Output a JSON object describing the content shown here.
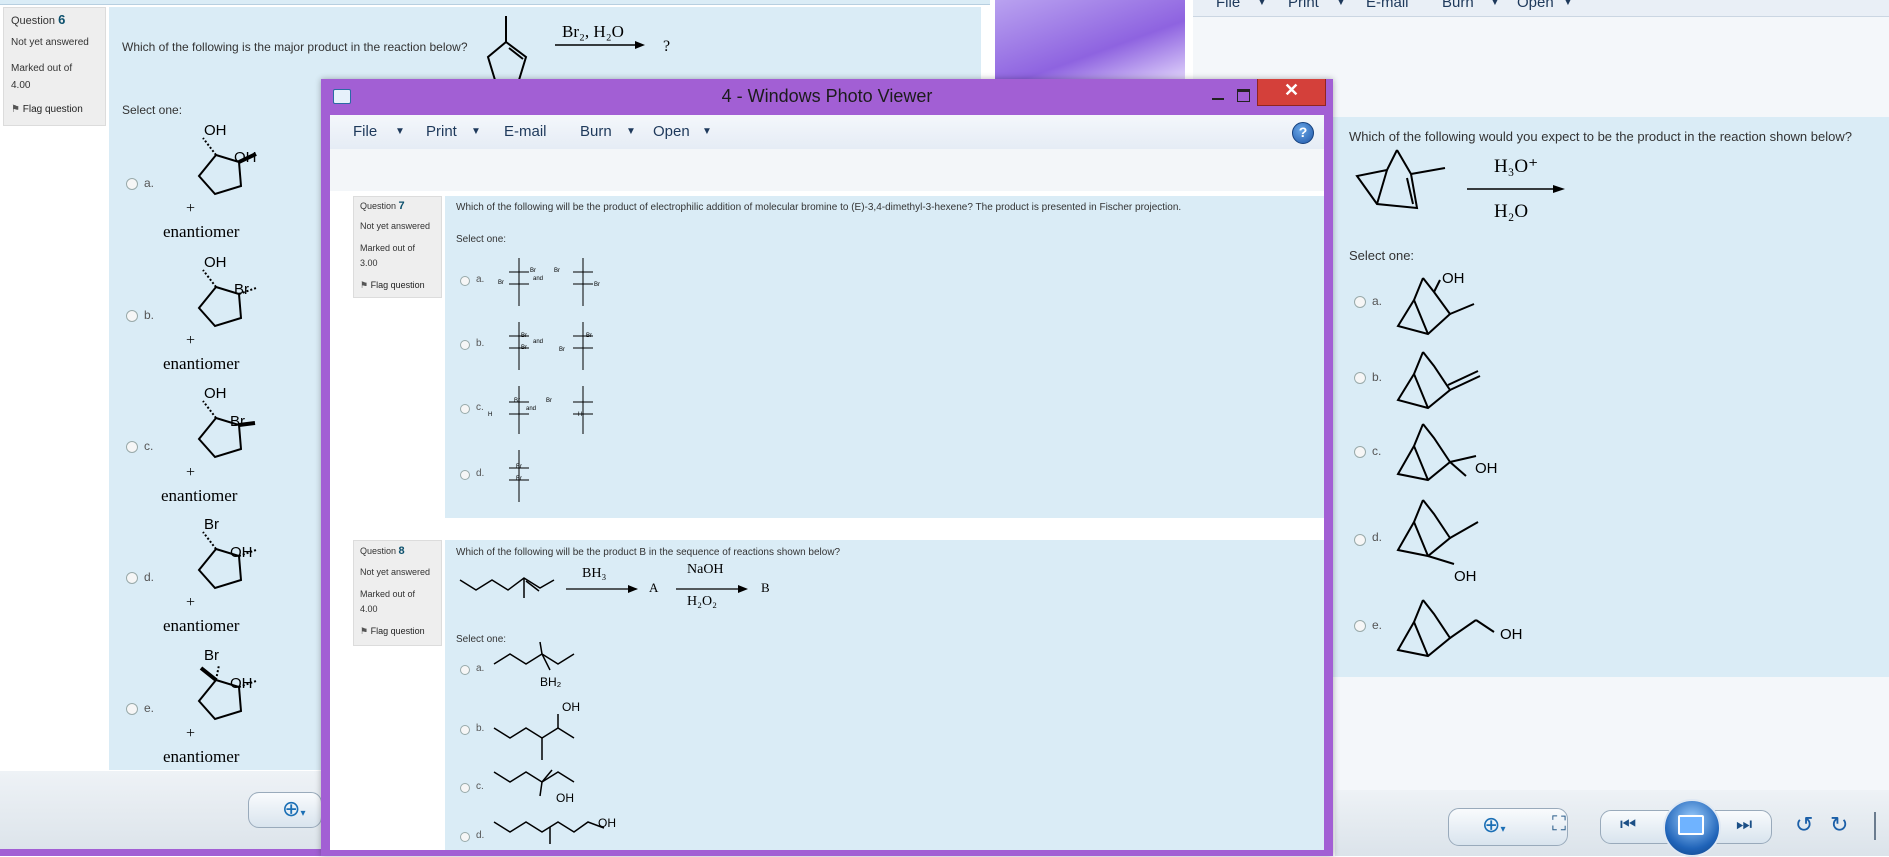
{
  "left_window": {
    "question": {
      "label": "Question",
      "number": "6",
      "state": "Not yet answered",
      "marked_label": "Marked out of",
      "marked_value": "4.00",
      "flag": "Flag question",
      "text": "Which of the following is the major product in the reaction below?",
      "reagent": "Br₂, H₂O",
      "product_placeholder": "?",
      "select_one": "Select one:",
      "options": [
        {
          "letter": "a.",
          "plus": "+",
          "enantiomer": "enantiomer",
          "sub1": "OH",
          "sub2": "OH"
        },
        {
          "letter": "b.",
          "plus": "+",
          "enantiomer": "enantiomer",
          "sub1": "OH",
          "sub2": "Br"
        },
        {
          "letter": "c.",
          "plus": "+",
          "enantiomer": "enantiomer",
          "sub1": "OH",
          "sub2": "Br"
        },
        {
          "letter": "d.",
          "plus": "+",
          "enantiomer": "enantiomer",
          "sub1": "Br",
          "sub2": "OH"
        },
        {
          "letter": "e.",
          "plus": "+",
          "enantiomer": "enantiomer",
          "sub1": "Br",
          "sub2": "OH"
        }
      ]
    }
  },
  "right_window": {
    "toolbar": [
      "File",
      "Print",
      "E-mail",
      "Burn",
      "Open"
    ],
    "question": {
      "text": "Which of the following would you expect to be the product in the reaction shown below?",
      "reagent_top": "H₃O⁺",
      "reagent_bottom": "H₂O",
      "select_one": "Select one:",
      "options": [
        {
          "letter": "a.",
          "label": "OH"
        },
        {
          "letter": "b.",
          "label": ""
        },
        {
          "letter": "c.",
          "label": "OH"
        },
        {
          "letter": "d.",
          "label": "OH"
        },
        {
          "letter": "e.",
          "label": "OH"
        }
      ]
    }
  },
  "photo_viewer": {
    "title": "4 - Windows Photo Viewer",
    "toolbar": [
      "File",
      "Print",
      "E-mail",
      "Burn",
      "Open"
    ],
    "help": "?",
    "q7": {
      "label": "Question",
      "number": "7",
      "state": "Not yet answered",
      "marked_label": "Marked out of",
      "marked_value": "3.00",
      "flag": "Flag question",
      "text": "Which of the following will be the product of electrophilic addition of molecular bromine to (E)-3,4-dimethyl-3-hexene? The product is presented in Fischer projection.",
      "select_one": "Select one:",
      "options": [
        {
          "letter": "a.",
          "and": "and",
          "l1": "Br",
          "l2": "Br",
          "r1": "Br",
          "r2": "Br"
        },
        {
          "letter": "b.",
          "and": "and",
          "l1": "Br",
          "l2": "Br",
          "r1": "Br",
          "r2": "Br"
        },
        {
          "letter": "c.",
          "and": "and",
          "l1": "Br",
          "l2": "H",
          "r1": "Br",
          "r2": "H"
        },
        {
          "letter": "d.",
          "and": "",
          "l1": "Br",
          "l2": "Br",
          "r1": "",
          "r2": ""
        }
      ]
    },
    "q8": {
      "label": "Question",
      "number": "8",
      "state": "Not yet answered",
      "marked_label": "Marked out of",
      "marked_value": "4.00",
      "flag": "Flag question",
      "text": "Which of the following will be the product B in the sequence of reactions shown below?",
      "reagent1": "BH₃",
      "intermediate": "A",
      "reagent2_top": "NaOH",
      "reagent2_bottom": "H₂O₂",
      "product": "B",
      "select_one": "Select one:",
      "options": [
        {
          "letter": "a.",
          "label": "BH₂"
        },
        {
          "letter": "b.",
          "label": "OH"
        },
        {
          "letter": "c.",
          "label": "OH"
        },
        {
          "letter": "d.",
          "label": "OH"
        }
      ]
    }
  },
  "colors": {
    "moodle_bg": "#daecf6",
    "viewer_frame": "#a25fd4",
    "close_red": "#d4403a",
    "question_number": "#0b4f6c"
  }
}
